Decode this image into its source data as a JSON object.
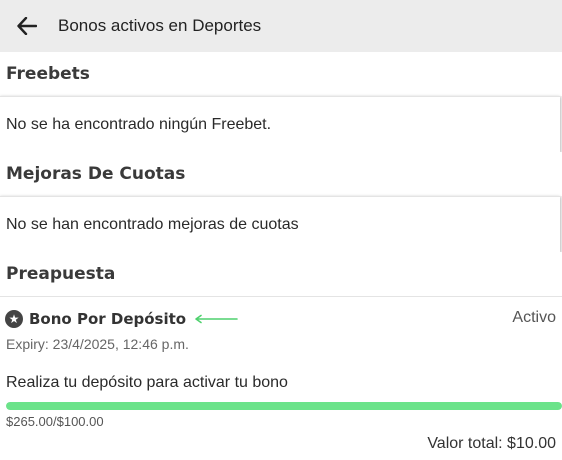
{
  "header": {
    "title": "Bonos activos en Deportes",
    "back_icon": "arrow-left-icon"
  },
  "sections": {
    "freebets": {
      "title": "Freebets",
      "empty_text": "No se ha encontrado ningún Freebet."
    },
    "odds_boosts": {
      "title": "Mejoras De Cuotas",
      "empty_text": "No se han encontrado mejoras de cuotas"
    },
    "prebet": {
      "title": "Preapuesta",
      "bonus": {
        "icon": "star-badge-icon",
        "name": "Bono Por Depósito",
        "status": "Activo",
        "expiry": "Expiry: 23/4/2025, 12:46 p.m.",
        "description": "Realiza tu depósito para activar tu bono",
        "progress_fraction": 1.0,
        "amounts": "$265.00/$100.00",
        "total": "Valor total: $10.00",
        "accent_color": "#6be38a",
        "annotation_arrow_color": "#4fd16e"
      }
    }
  }
}
